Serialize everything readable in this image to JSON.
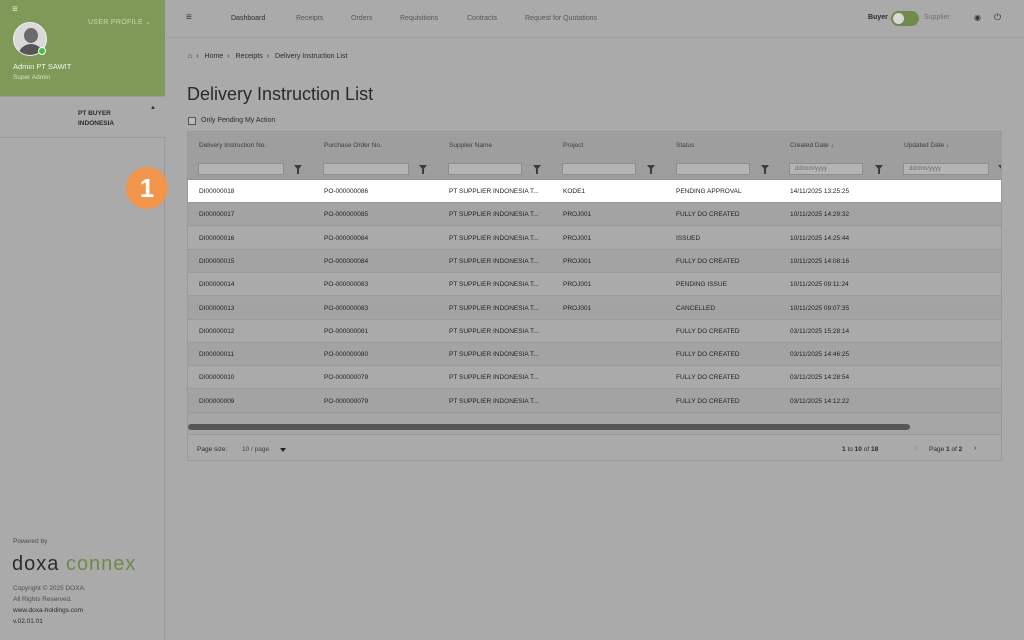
{
  "sidebar": {
    "user_profile_label": "USER PROFILE",
    "user_name": "Admin PT SAWIT",
    "user_role": "Super Admin",
    "company": "PT BUYER INDONESIA",
    "powered_by": "Powered by",
    "brand_part1": "doxa",
    "brand_part2": "connex",
    "copyright_line1": "Copyright © 2025 DOXA.",
    "copyright_line2": "All Rights Reserved.",
    "website": "www.doxa-holdings.com",
    "version": "v.02.01.01"
  },
  "topnav": {
    "items": [
      "Dashboard",
      "Receipts",
      "Orders",
      "Requisitions",
      "Contracts",
      "Request for Quotations"
    ],
    "buyer_label": "Buyer",
    "supplier_label": "Supplier"
  },
  "breadcrumb": [
    "Home",
    "Receipts",
    "Delivery Instruction List"
  ],
  "page_title": "Delivery Instruction List",
  "pending_checkbox_label": "Only Pending My Action",
  "grid": {
    "columns": [
      "Delivery Instruction No.",
      "Purchase Order No.",
      "Supplier Name",
      "Project",
      "Status",
      "Created Date",
      "Updated Date"
    ],
    "date_placeholder": "dd/mm/yyyy",
    "rows": [
      {
        "di": "DI00000018",
        "po": "PO-000000086",
        "supplier": "PT SUPPLIER INDONESIA T...",
        "project": "KODE1",
        "status": "PENDING APPROVAL",
        "created": "14/11/2025 13:25:25"
      },
      {
        "di": "DI00000017",
        "po": "PO-000000085",
        "supplier": "PT SUPPLIER INDONESIA T...",
        "project": "PROJ001",
        "status": "FULLY DO CREATED",
        "created": "10/11/2025 14:29:32"
      },
      {
        "di": "DI00000016",
        "po": "PO-000000084",
        "supplier": "PT SUPPLIER INDONESIA T...",
        "project": "PROJ001",
        "status": "ISSUED",
        "created": "10/11/2025 14:25:44"
      },
      {
        "di": "DI00000015",
        "po": "PO-000000084",
        "supplier": "PT SUPPLIER INDONESIA T...",
        "project": "PROJ001",
        "status": "FULLY DO CREATED",
        "created": "10/11/2025 14:08:16"
      },
      {
        "di": "DI00000014",
        "po": "PO-000000083",
        "supplier": "PT SUPPLIER INDONESIA T...",
        "project": "PROJ001",
        "status": "PENDING ISSUE",
        "created": "10/11/2025 09:11:24"
      },
      {
        "di": "DI00000013",
        "po": "PO-000000083",
        "supplier": "PT SUPPLIER INDONESIA T...",
        "project": "PROJ001",
        "status": "CANCELLED",
        "created": "10/11/2025 09:07:35"
      },
      {
        "di": "DI00000012",
        "po": "PO-000000081",
        "supplier": "PT SUPPLIER INDONESIA T...",
        "project": "",
        "status": "FULLY DO CREATED",
        "created": "03/11/2025 15:28:14"
      },
      {
        "di": "DI00000011",
        "po": "PO-000000080",
        "supplier": "PT SUPPLIER INDONESIA T...",
        "project": "",
        "status": "FULLY DO CREATED",
        "created": "03/11/2025 14:46:25"
      },
      {
        "di": "DI00000010",
        "po": "PO-000000079",
        "supplier": "PT SUPPLIER INDONESIA T...",
        "project": "",
        "status": "FULLY DO CREATED",
        "created": "03/11/2025 14:28:54"
      },
      {
        "di": "DI00000009",
        "po": "PO-000000079",
        "supplier": "PT SUPPLIER INDONESIA T...",
        "project": "",
        "status": "FULLY DO CREATED",
        "created": "03/11/2025 14:12:22"
      }
    ]
  },
  "pager": {
    "page_size_label": "Page size:",
    "page_size_value": "10 / page",
    "range_from": "1",
    "range_to_word": "to",
    "range_to": "10",
    "range_of_word": "of",
    "range_total": "18",
    "page_word": "Page",
    "page_current": "1",
    "page_of_word": "of",
    "page_total": "2"
  },
  "step_badge": "1",
  "colors": {
    "sidebar_green": "#7f9a58",
    "badge_orange": "#f0954a",
    "toggle_green": "#6f8a4a"
  }
}
